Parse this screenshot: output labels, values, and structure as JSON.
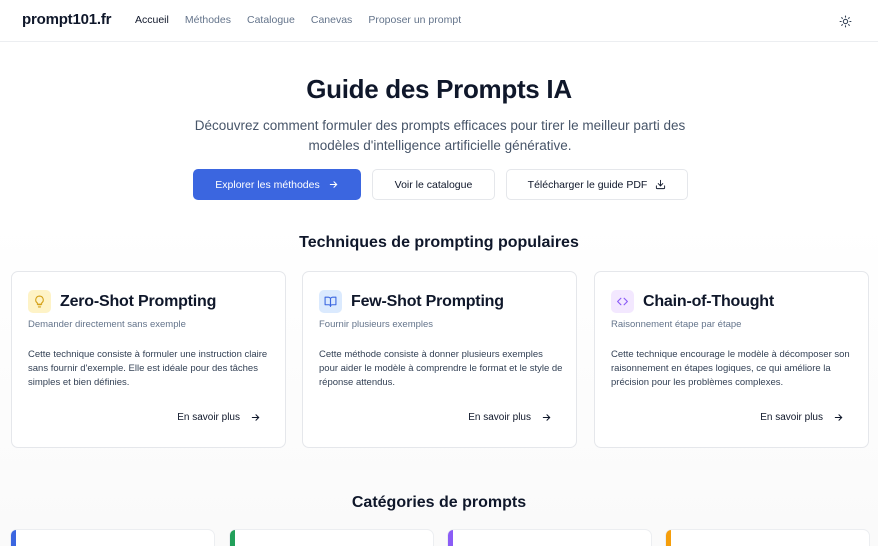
{
  "header": {
    "logo": "prompt101.fr",
    "nav": [
      "Accueil",
      "Méthodes",
      "Catalogue",
      "Canevas",
      "Proposer un prompt"
    ],
    "theme_icon": "sun-icon"
  },
  "hero": {
    "title": "Guide des Prompts IA",
    "subtitle": "Découvrez comment formuler des prompts efficaces pour tirer le meilleur parti des modèles d'intelligence artificielle générative.",
    "buttons": {
      "primary": "Explorer les méthodes",
      "catalog": "Voir le catalogue",
      "pdf": "Télécharger le guide PDF"
    }
  },
  "techniques": {
    "section_title": "Techniques de prompting populaires",
    "cards": [
      {
        "title": "Zero-Shot Prompting",
        "subtitle": "Demander directement sans exemple",
        "description": "Cette technique consiste à formuler une instruction claire sans fournir d'exemple. Elle est idéale pour des tâches simples et bien définies.",
        "link": "En savoir plus",
        "icon": "lightbulb-icon",
        "icon_bg": "#fef3c7",
        "icon_color": "#d4a017"
      },
      {
        "title": "Few-Shot Prompting",
        "subtitle": "Fournir plusieurs exemples",
        "description": "Cette méthode consiste à donner plusieurs exemples pour aider le modèle à comprendre le format et le style de réponse attendus.",
        "link": "En savoir plus",
        "icon": "book-open-icon",
        "icon_bg": "#dbeafe",
        "icon_color": "#3b66e0"
      },
      {
        "title": "Chain-of-Thought",
        "subtitle": "Raisonnement étape par étape",
        "description": "Cette technique encourage le modèle à décomposer son raisonnement en étapes logiques, ce qui améliore la précision pour les problèmes complexes.",
        "link": "En savoir plus",
        "icon": "code-icon",
        "icon_bg": "#f3e8ff",
        "icon_color": "#8b5cf6"
      }
    ]
  },
  "categories": {
    "section_title": "Catégories de prompts",
    "accent_colors": [
      "#3b66e0",
      "#22a05a",
      "#8b5cf6",
      "#f59e0b"
    ]
  },
  "colors": {
    "primary": "#3b66e0"
  }
}
